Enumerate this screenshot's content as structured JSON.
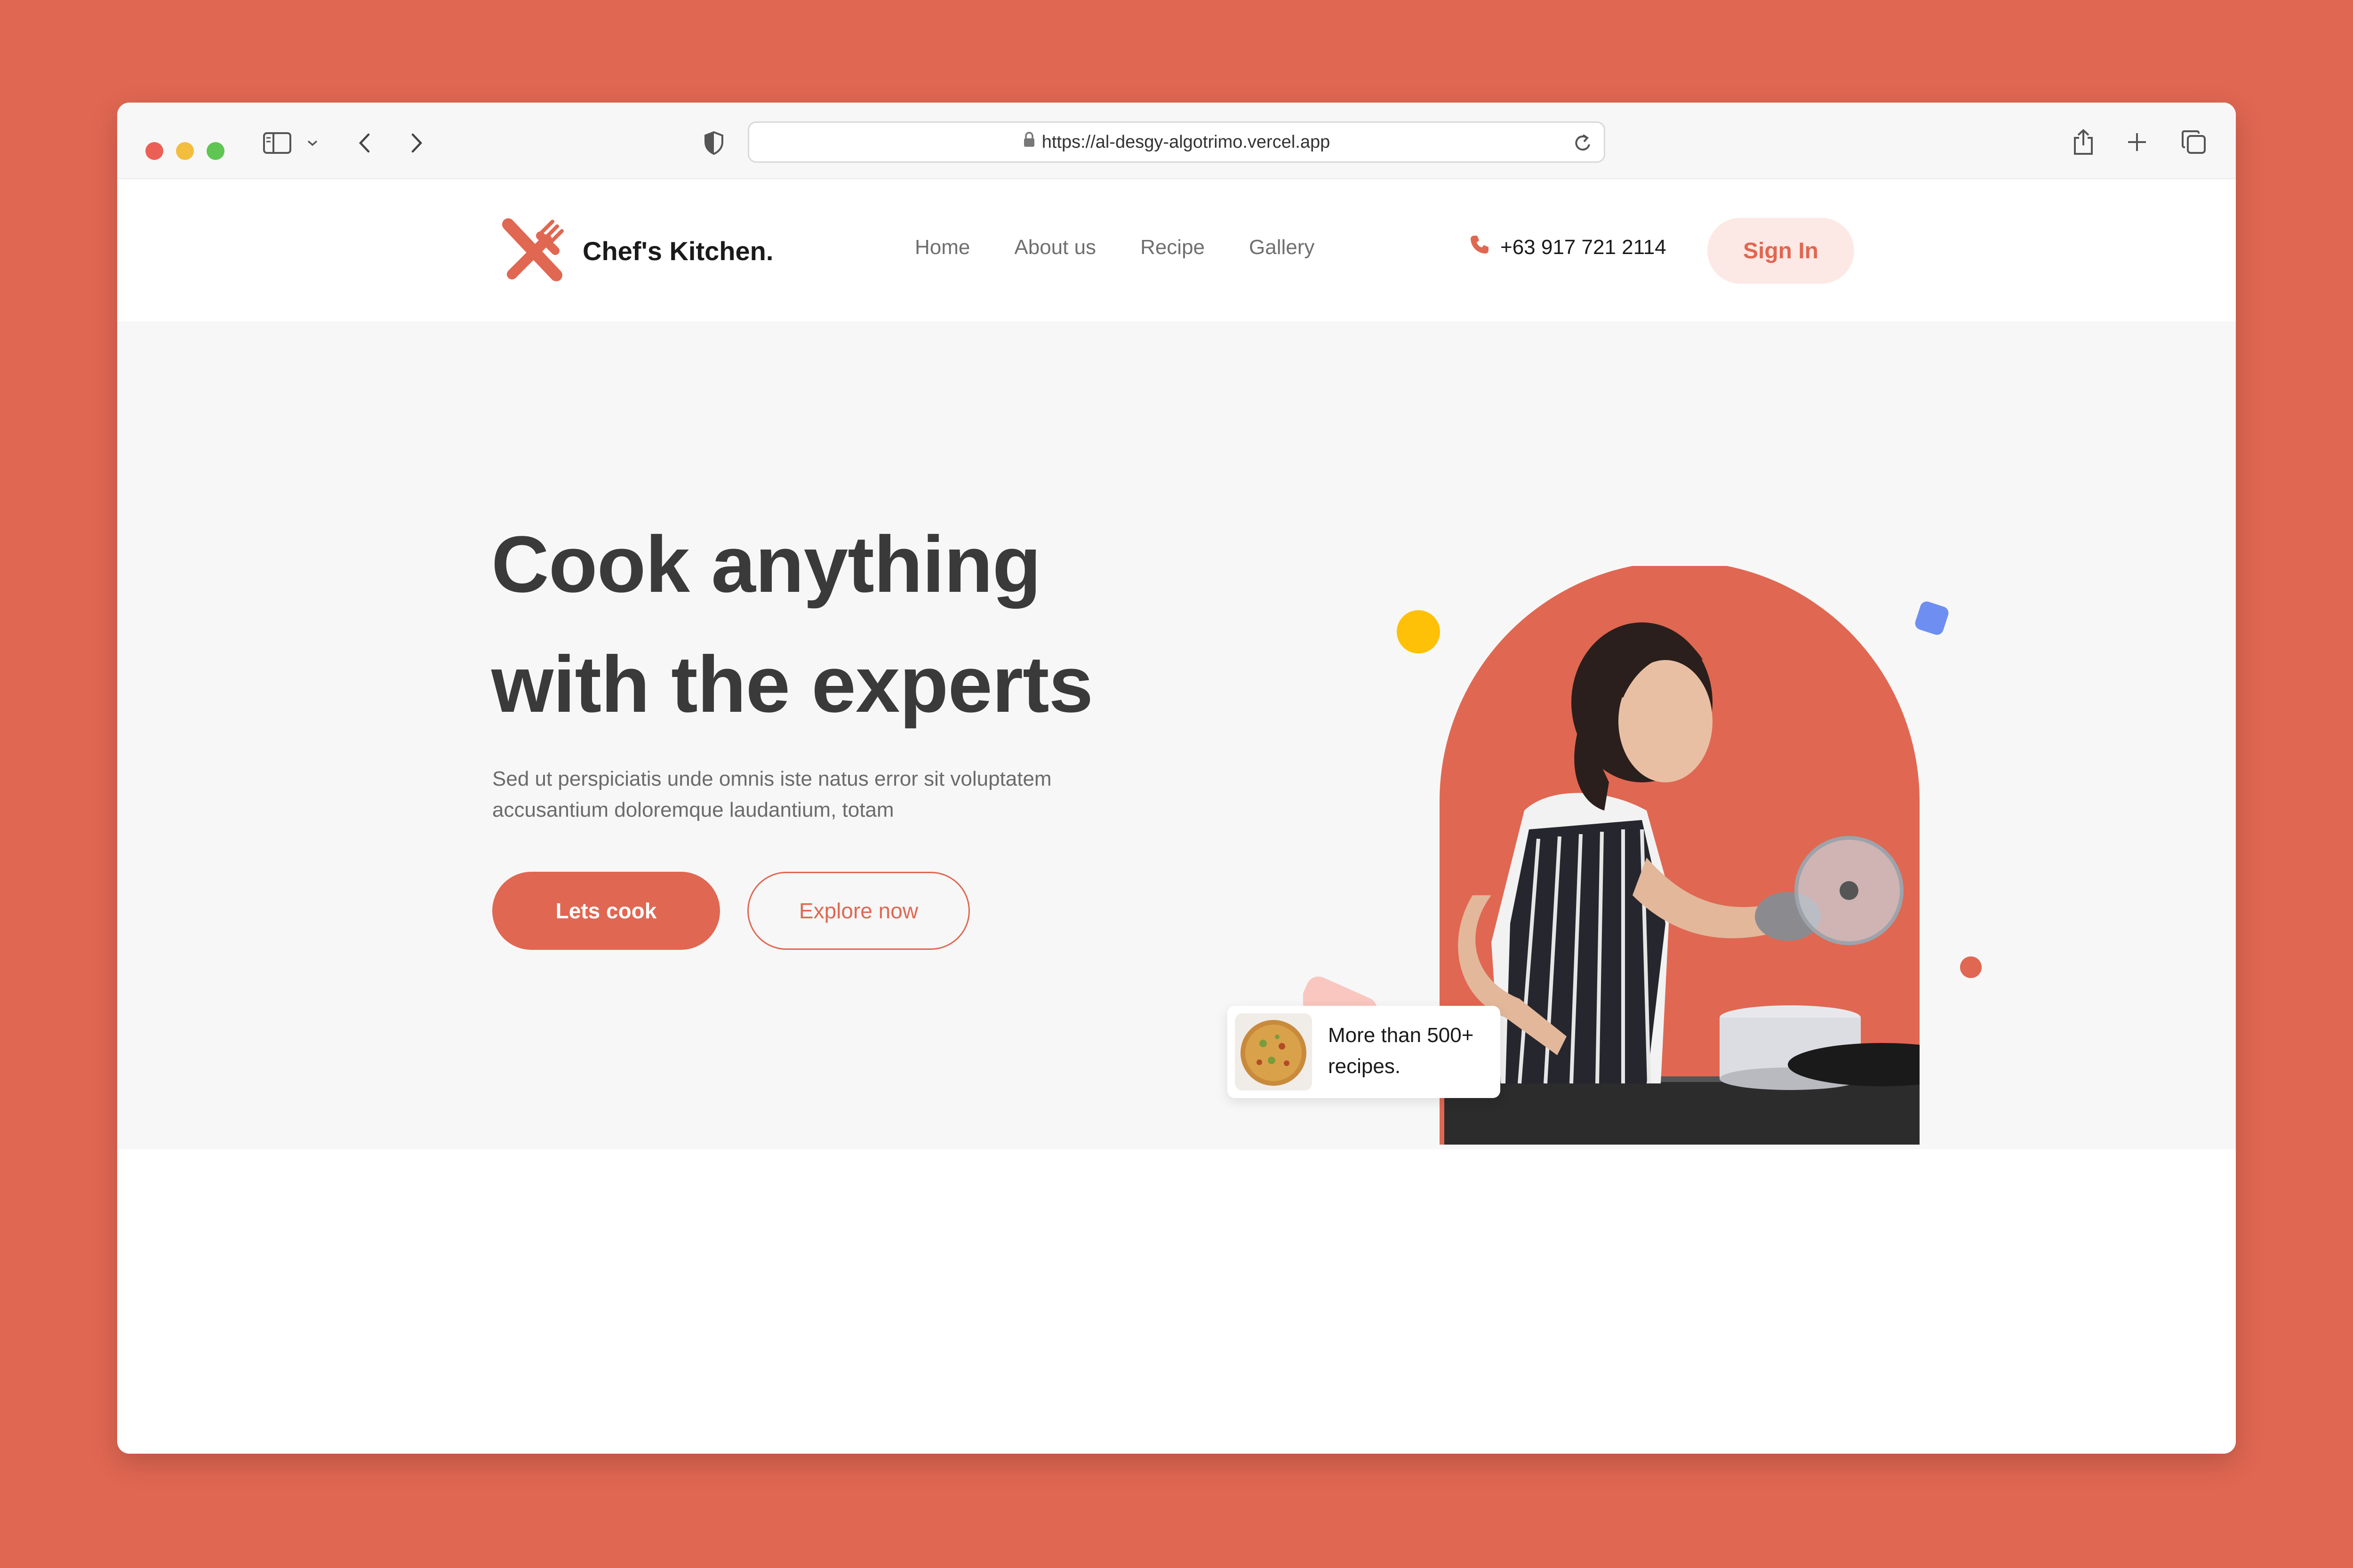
{
  "browser": {
    "url": "https://al-desgy-algotrimo.vercel.app"
  },
  "site": {
    "brand": "Chef's Kitchen.",
    "nav": [
      {
        "label": "Home"
      },
      {
        "label": "About us"
      },
      {
        "label": "Recipe"
      },
      {
        "label": "Gallery"
      }
    ],
    "phone": "+63 917 721 2114",
    "signin_label": "Sign In"
  },
  "hero": {
    "title_line1": "Cook anything",
    "title_line2": "with the experts",
    "description_line1": "Sed ut perspiciatis unde omnis iste natus error sit voluptatem",
    "description_line2": "accusantium doloremque laudantium, totam",
    "primary_button": "Lets cook",
    "secondary_button": "Explore now",
    "badge_line1": "More than 500+",
    "badge_line2": "recipes."
  },
  "colors": {
    "accent": "#E06752",
    "accent_light": "#FCE8E4",
    "hero_bg": "#F7F7F7",
    "heading": "#3A3A3A",
    "yellow_dot": "#FFC107",
    "blue_square": "#6E8EF2",
    "pink_square": "#F9C7BF"
  },
  "icons": {
    "sidebar": "sidebar-icon",
    "shield": "shield-icon",
    "lock": "lock-icon",
    "reload": "reload-icon",
    "share": "share-icon",
    "new_tab": "plus-icon",
    "tabs": "tabs-icon",
    "logo": "fork-knife-icon",
    "phone": "phone-icon"
  }
}
